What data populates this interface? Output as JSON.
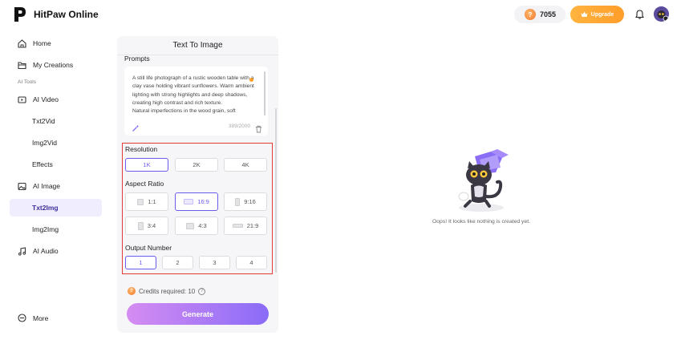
{
  "app": {
    "title": "HitPaw Online"
  },
  "header": {
    "credits": "7055",
    "upgrade_label": "Upgrade",
    "icons": [
      "logo-icon",
      "coin-icon",
      "crown-icon",
      "bell-icon",
      "avatar"
    ]
  },
  "sidebar": {
    "items": [
      {
        "label": "Home",
        "icon": "home-icon"
      },
      {
        "label": "My Creations",
        "icon": "folder-icon"
      }
    ],
    "section_label": "AI Tools",
    "video": {
      "label": "AI Video",
      "icon": "video-icon",
      "children": [
        "Txt2Vid",
        "Img2Vid",
        "Effects"
      ]
    },
    "image": {
      "label": "AI Image",
      "icon": "image-icon",
      "children": [
        "Txt2Img",
        "Img2Img"
      ],
      "active": "Txt2Img"
    },
    "audio": {
      "label": "AI Audio",
      "icon": "music-icon"
    },
    "more_label": "More"
  },
  "panel": {
    "title": "Text To Image",
    "prompts_label": "Prompts",
    "prompt_text": "A still life photograph of a rustic wooden table with a clay vase holding vibrant sunflowers. Warm ambient lighting with strong highlights and deep shadows, creating high contrast and rich texture.\nNatural imperfections in the wood grain, soft",
    "prompt_count": "389/2000",
    "resolution": {
      "label": "Resolution",
      "options": [
        "1K",
        "2K",
        "4K"
      ],
      "selected": "1K"
    },
    "aspect_ratio": {
      "label": "Aspect Ratio",
      "options": [
        "1:1",
        "16:9",
        "9:16",
        "3:4",
        "4:3",
        "21:9"
      ],
      "selected": "16:9"
    },
    "output_number": {
      "label": "Output Number",
      "options": [
        "1",
        "2",
        "3",
        "4"
      ],
      "selected": "1"
    },
    "credits_required": "Credits required: 10",
    "generate_label": "Generate"
  },
  "empty_state": {
    "message": "Oops! It looks like nothing is created yet."
  },
  "colors": {
    "accent": "#6b5cf0",
    "upgrade": "#ff9d2a",
    "highlight_outline": "#e03a3a"
  }
}
